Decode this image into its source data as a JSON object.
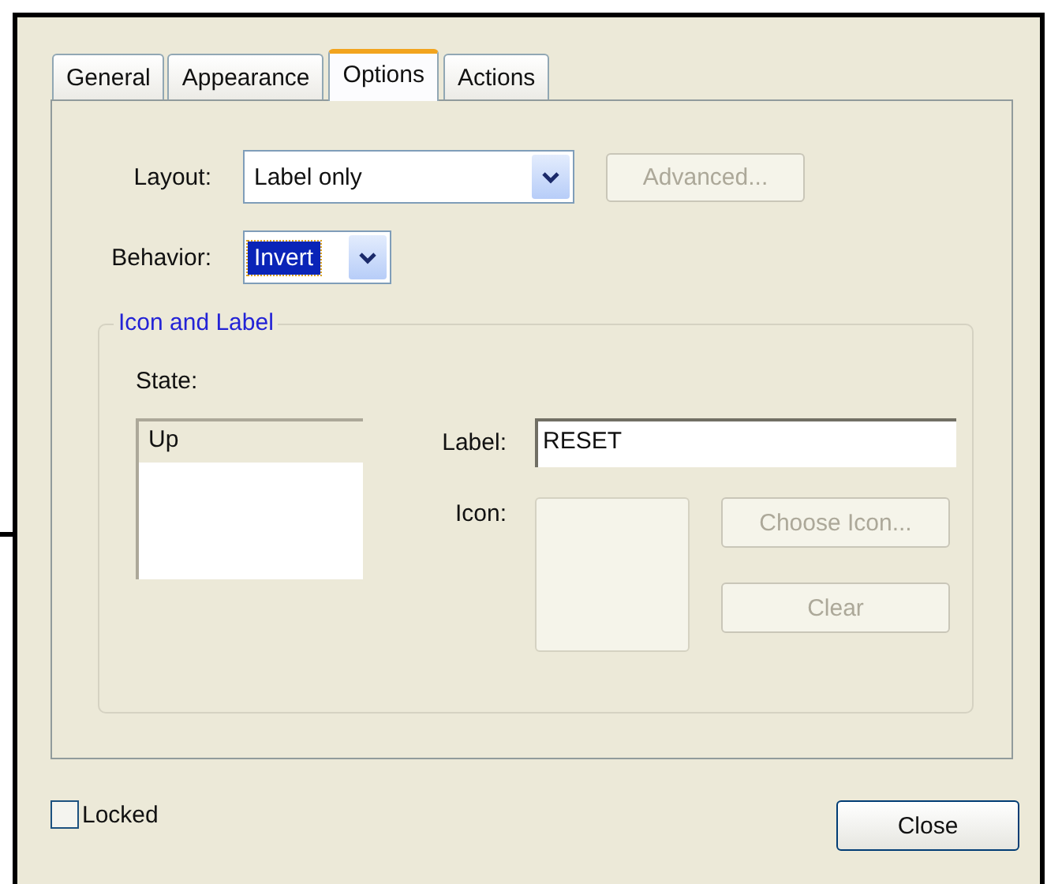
{
  "tabs": [
    {
      "label": "General",
      "selected": false
    },
    {
      "label": "Appearance",
      "selected": false
    },
    {
      "label": "Options",
      "selected": true
    },
    {
      "label": "Actions",
      "selected": false
    }
  ],
  "layout": {
    "label": "Layout:",
    "value": "Label only"
  },
  "advanced_button": {
    "label": "Advanced...",
    "disabled": true
  },
  "behavior": {
    "label": "Behavior:",
    "value": "Invert",
    "focused": true
  },
  "group": {
    "title": "Icon and Label",
    "state_label": "State:",
    "states": [
      {
        "label": "Up",
        "selected": true
      }
    ],
    "label_field": {
      "label": "Label:",
      "value": "RESET"
    },
    "icon_label": "Icon:",
    "buttons": [
      {
        "label": "Choose Icon...",
        "disabled": true
      },
      {
        "label": "Clear",
        "disabled": true
      }
    ]
  },
  "locked": {
    "label": "Locked",
    "checked": false
  },
  "close_button": {
    "label": "Close"
  }
}
